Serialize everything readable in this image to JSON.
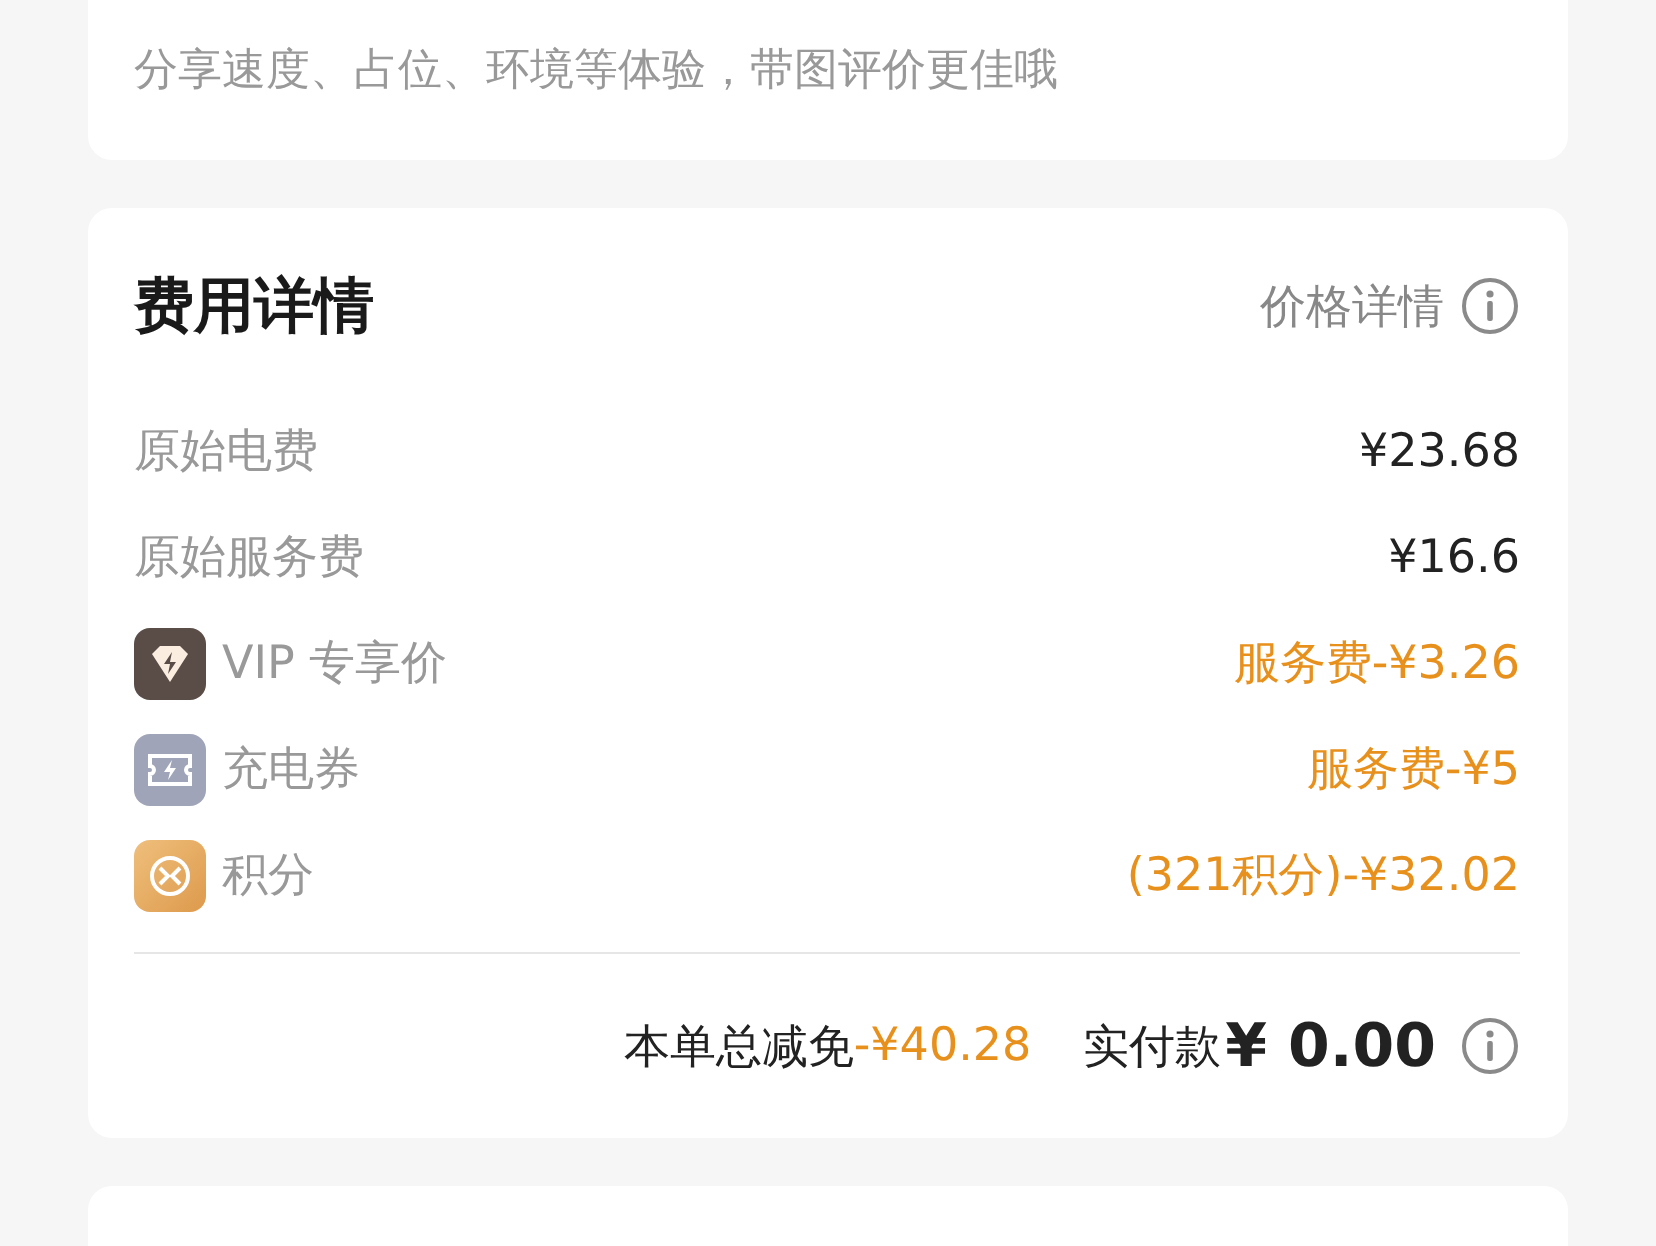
{
  "review": {
    "hint": "分享速度、占位、环境等体验，带图评价更佳哦"
  },
  "fees": {
    "title": "费用详情",
    "detail_link": "价格详情",
    "rows": [
      {
        "kind": "plain",
        "label": "原始电费",
        "value": "¥23.68",
        "discount": false
      },
      {
        "kind": "plain",
        "label": "原始服务费",
        "value": "¥16.6",
        "discount": false
      },
      {
        "kind": "vip",
        "label": "VIP 专享价",
        "value": "服务费-¥3.26",
        "discount": true
      },
      {
        "kind": "coupon",
        "label": "充电券",
        "value": "服务费-¥5",
        "discount": true
      },
      {
        "kind": "points",
        "label": "积分",
        "value": "(321积分)-¥32.02",
        "discount": true
      }
    ],
    "total_reduction_label": "本单总减免",
    "total_reduction": "-¥40.28",
    "paid_label": "实付款",
    "paid": "¥ 0.00"
  }
}
